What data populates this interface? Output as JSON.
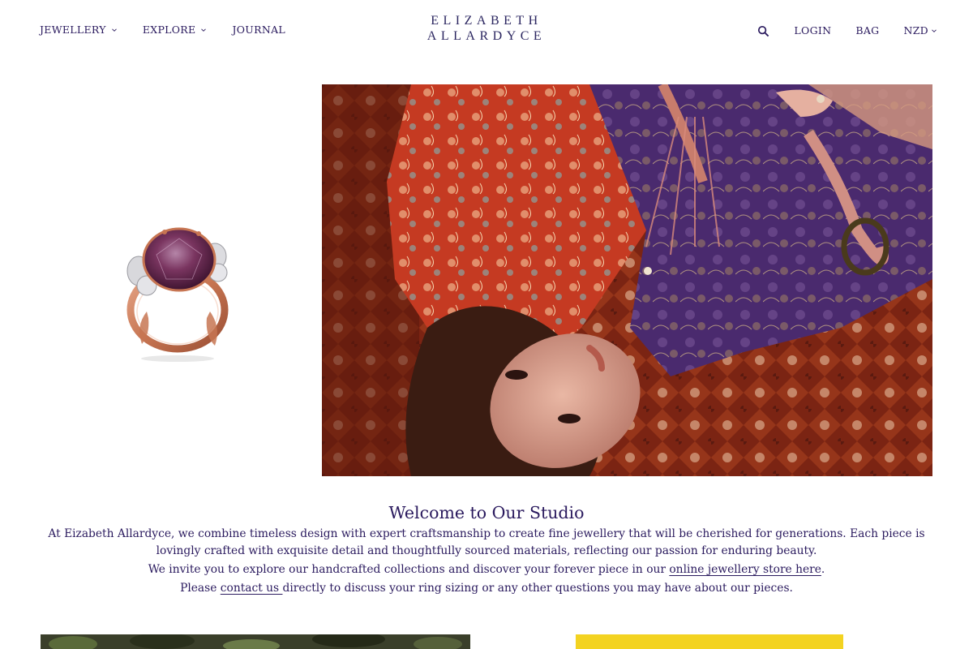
{
  "nav": {
    "left": [
      {
        "label": "JEWELLERY",
        "dropdown": true
      },
      {
        "label": "EXPLORE",
        "dropdown": true
      },
      {
        "label": "JOURNAL",
        "dropdown": false
      }
    ],
    "logo_line1": "ELIZABETH",
    "logo_line2": "ALLARDYCE",
    "right": {
      "search_icon": "search-icon",
      "login": "LOGIN",
      "bag": "BAG",
      "currency": "NZD"
    }
  },
  "welcome": {
    "title": "Welcome to Our Studio",
    "para1": "At Eizabeth Allardyce, we combine timeless design with expert craftsmanship to create fine jewellery that will be cherished for generations. Each piece is lovingly crafted with exquisite detail and thoughtfully sourced materials, reflecting our passion for enduring beauty.",
    "para2_before": "We invite you to explore our handcrafted collections and discover your forever piece in our ",
    "para2_link": "online jewellery store here",
    "para2_after": ".",
    "para3_before": "Please ",
    "para3_link": "contact us ",
    "para3_after": "directly to discuss your ring sizing or any other questions you may have about our pieces."
  },
  "colors": {
    "text": "#2a1a5e",
    "yellow_tile": "#f3d321",
    "rug_red": "#8c2a18"
  }
}
